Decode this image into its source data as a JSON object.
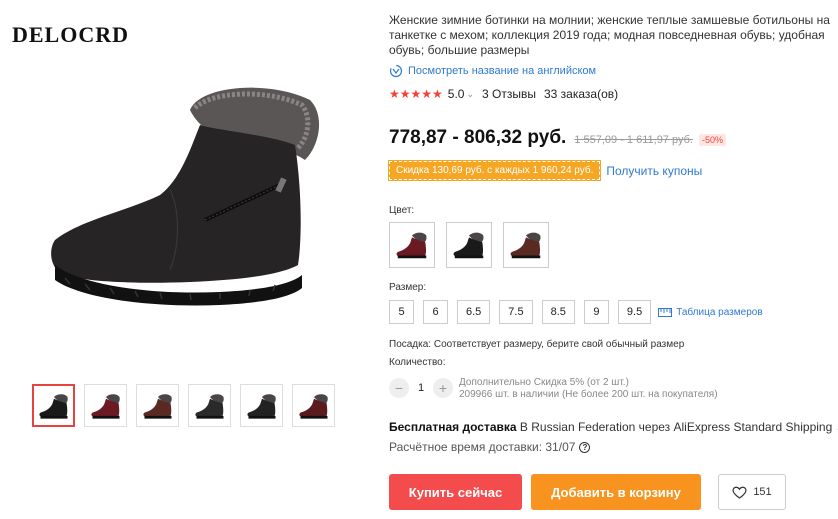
{
  "brand": "DELOCRD",
  "product": {
    "title": "Женские зимние ботинки на молнии; женские теплые замшевые ботильоны на танкетке с мехом; коллекция 2019 года; модная повседневная обувь; удобная обувь; большие размеры",
    "translate_link": "Посмотреть название на английском",
    "rating": "5.0",
    "reviews": "3 Отзывы",
    "orders": "33 заказа(ов)",
    "price": "778,87 - 806,32 руб.",
    "old_price": "1 557,09 - 1 611,97 руб.",
    "discount": "-50%",
    "coupon": "Скидка 130,69 руб. с каждых 1 960,24 руб.",
    "get_coupons": "Получить купоны"
  },
  "thumbnails": [
    {
      "color": "#1a1a1a",
      "active": true
    },
    {
      "color": "#6b1a24",
      "active": false
    },
    {
      "color": "#5a2a22",
      "active": false
    },
    {
      "color": "#2a2a2a",
      "active": false
    },
    {
      "color": "#222222",
      "active": false
    },
    {
      "color": "#5a1a1e",
      "active": false
    }
  ],
  "color_section": {
    "label": "Цвет:",
    "options": [
      {
        "name": "wine-red",
        "color": "#6b1a24"
      },
      {
        "name": "black",
        "color": "#1a1a1a"
      },
      {
        "name": "brown",
        "color": "#5a2a22"
      }
    ]
  },
  "size_section": {
    "label": "Размер:",
    "options": [
      "5",
      "6",
      "6.5",
      "7.5",
      "8.5",
      "9",
      "9.5"
    ],
    "size_chart": "Таблица размеров"
  },
  "fit": "Посадка: Соответствует размеру, берите свой обычный размер",
  "quantity": {
    "label": "Количество:",
    "value": "1",
    "extra_discount": "Дополнительно Скидка 5% (от 2 шт.)",
    "stock": "209966 шт. в наличии (Не более 200 шт. на покупателя)"
  },
  "shipping": {
    "free": "Бесплатная доставка",
    "details": "В Russian Federation через AliExpress Standard Shipping",
    "eta": "Расчётное время доставки: 31/07"
  },
  "actions": {
    "buy_now": "Купить сейчас",
    "add_to_cart": "Добавить в корзину",
    "wishlist_count": "151"
  },
  "colors": {
    "accent_red": "#f44c4c",
    "accent_orange": "#f7931e",
    "link_blue": "#2e7ad1",
    "star": "#f44336"
  }
}
